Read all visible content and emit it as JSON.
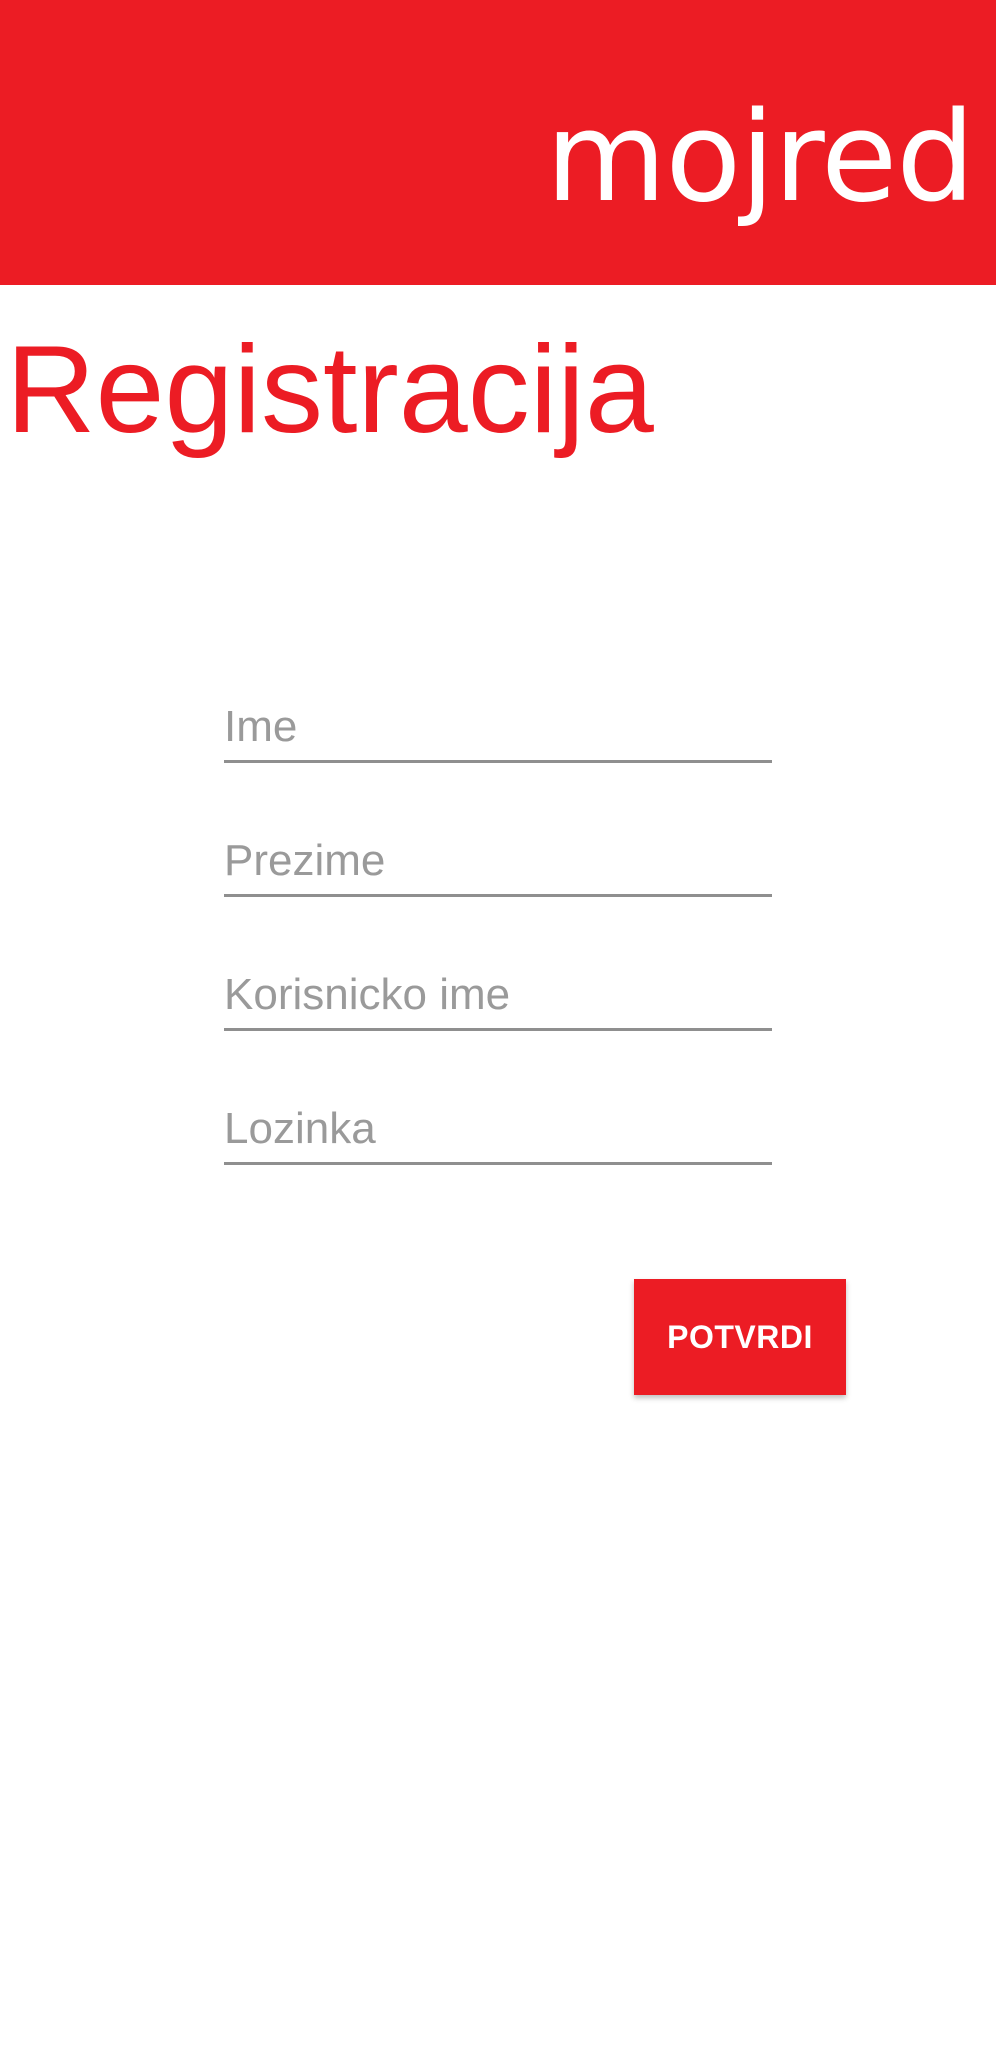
{
  "header": {
    "brand": "mojred",
    "background_color": "#ec1c24"
  },
  "page": {
    "title": "Registracija",
    "accent_color": "#ec1c24"
  },
  "form": {
    "fields": [
      {
        "placeholder": "Ime",
        "value": ""
      },
      {
        "placeholder": "Prezime",
        "value": ""
      },
      {
        "placeholder": "Korisnicko ime",
        "value": ""
      },
      {
        "placeholder": "Lozinka",
        "value": ""
      }
    ],
    "submit_label": "POTVRDI"
  }
}
